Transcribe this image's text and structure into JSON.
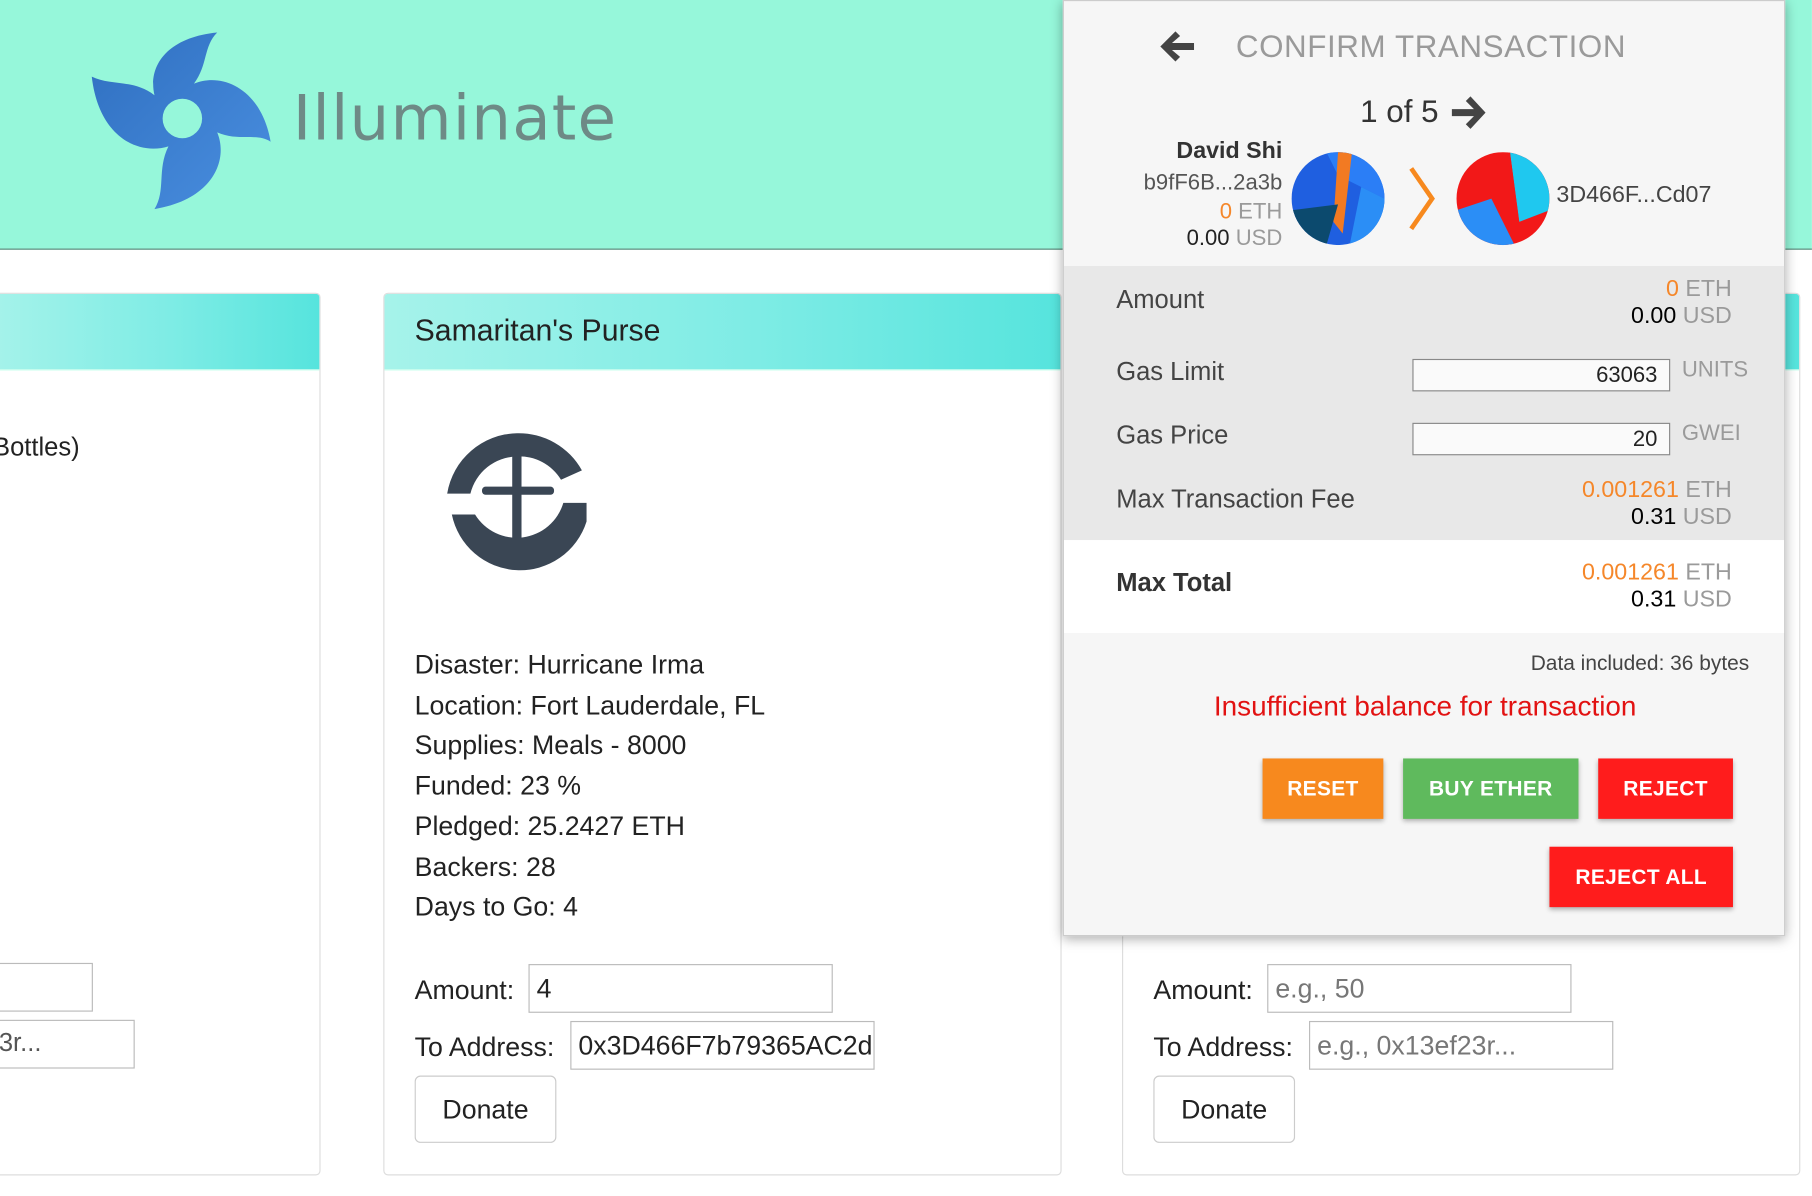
{
  "header": {
    "brand": "Illuminate"
  },
  "cards": {
    "left": {
      "partial_text": "Bottles)",
      "to_address_placeholder": "3r..."
    },
    "middle": {
      "title": "Samaritan's Purse",
      "info": [
        {
          "key": "Disaster:",
          "value": " Hurricane Irma"
        },
        {
          "key": "Location:",
          "value": " Fort Lauderdale, FL"
        },
        {
          "key": "Supplies:",
          "value": " Meals - 8000"
        },
        {
          "key": "Funded:",
          "value": " 23 %"
        },
        {
          "key": "Pledged:",
          "value": " 25.2427 ETH"
        },
        {
          "key": "Backers:",
          "value": " 28"
        },
        {
          "key": "Days to Go:",
          "value": " 4"
        }
      ],
      "amount_label": "Amount:",
      "amount_value": "4",
      "to_label": "To Address:",
      "to_value": "0x3D466F7b79365AC2d",
      "donate": "Donate"
    },
    "right": {
      "amount_label": "Amount:",
      "amount_placeholder": "e.g., 50",
      "to_label": "To Address:",
      "to_placeholder": "e.g., 0x13ef23r...",
      "donate": "Donate"
    }
  },
  "popup": {
    "title": "CONFIRM TRANSACTION",
    "nav": "1 of 5",
    "sender": {
      "name": "David Shi",
      "address": "b9fF6B...2a3b",
      "eth_value": "0",
      "eth_unit": "ETH",
      "usd_value": "0.00",
      "usd_unit": "USD"
    },
    "recipient": "3D466F...Cd07",
    "rows": {
      "amount": {
        "label": "Amount",
        "eth": "0",
        "eth_unit": "ETH",
        "usd": "0.00",
        "usd_unit": "USD"
      },
      "gas_limit": {
        "label": "Gas Limit",
        "value": "63063",
        "unit": "UNITS"
      },
      "gas_price": {
        "label": "Gas Price",
        "value": "20",
        "unit": "GWEI"
      },
      "max_fee": {
        "label": "Max Transaction Fee",
        "eth": "0.001261",
        "eth_unit": "ETH",
        "usd": "0.31",
        "usd_unit": "USD"
      },
      "max_total": {
        "label": "Max Total",
        "eth": "0.001261",
        "eth_unit": "ETH",
        "usd": "0.31",
        "usd_unit": "USD"
      }
    },
    "data_included": "Data included: 36 bytes",
    "error": "Insufficient balance for transaction",
    "buttons": {
      "reset": "RESET",
      "buy": "BUY ETHER",
      "reject": "REJECT",
      "reject_all": "REJECT ALL"
    },
    "colors": {
      "orange": "#f7891e",
      "green": "#5fba5d",
      "red": "#ff1c1c",
      "error": "#e21212"
    }
  }
}
